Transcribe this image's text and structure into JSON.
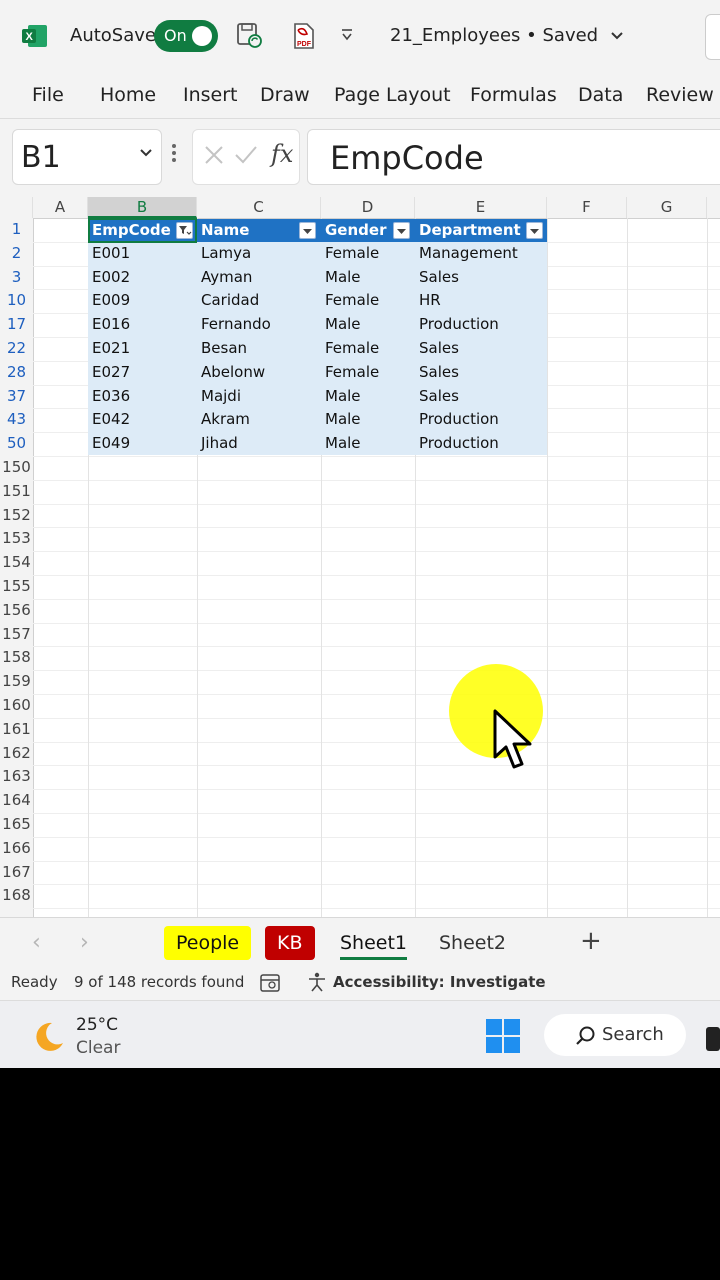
{
  "titlebar": {
    "app_icon": "excel-icon",
    "autosave_label": "AutoSave",
    "autosave_state": "On",
    "filename": "21_Employees • Saved"
  },
  "ribbon": {
    "tabs": [
      "File",
      "Home",
      "Insert",
      "Draw",
      "Page Layout",
      "Formulas",
      "Data",
      "Review"
    ]
  },
  "formula_bar": {
    "name_box": "B1",
    "fx_label": "fx",
    "content": "EmpCode"
  },
  "grid": {
    "columns": [
      "A",
      "B",
      "C",
      "D",
      "E",
      "F",
      "G"
    ],
    "selected_column": "B",
    "table_headers": [
      "EmpCode",
      "Name",
      "Gender",
      "Department"
    ],
    "rows": [
      {
        "row": "1",
        "cells": []
      },
      {
        "row": "2",
        "cells": [
          "E001",
          "Lamya",
          "Female",
          "Management"
        ]
      },
      {
        "row": "3",
        "cells": [
          "E002",
          "Ayman",
          "Male",
          "Sales"
        ]
      },
      {
        "row": "10",
        "cells": [
          "E009",
          "Caridad",
          "Female",
          "HR"
        ]
      },
      {
        "row": "17",
        "cells": [
          "E016",
          "Fernando",
          "Male",
          "Production"
        ]
      },
      {
        "row": "22",
        "cells": [
          "E021",
          "Besan",
          "Female",
          "Sales"
        ]
      },
      {
        "row": "28",
        "cells": [
          "E027",
          "Abelonw",
          "Female",
          "Sales"
        ]
      },
      {
        "row": "37",
        "cells": [
          "E036",
          "Majdi",
          "Male",
          "Sales"
        ]
      },
      {
        "row": "43",
        "cells": [
          "E042",
          "Akram",
          "Male",
          "Production"
        ]
      },
      {
        "row": "50",
        "cells": [
          "E049",
          "Jihad",
          "Male",
          "Production"
        ]
      }
    ],
    "empty_rows": [
      "150",
      "151",
      "152",
      "153",
      "154",
      "155",
      "156",
      "157",
      "158",
      "159",
      "160",
      "161",
      "162",
      "163",
      "164",
      "165",
      "166",
      "167",
      "168"
    ]
  },
  "sheets": {
    "tabs": [
      "People",
      "KB",
      "Sheet1",
      "Sheet2"
    ],
    "active": "Sheet1"
  },
  "status": {
    "ready": "Ready",
    "records": "9 of 148 records found",
    "accessibility": "Accessibility: Investigate"
  },
  "taskbar": {
    "temperature": "25°C",
    "condition": "Clear",
    "search_label": "Search"
  },
  "colors": {
    "excel_green": "#107c41",
    "table_header": "#1f72c4",
    "table_band": "#ddebf7",
    "people_tab": "#ffff00",
    "kb_tab": "#c00000"
  }
}
